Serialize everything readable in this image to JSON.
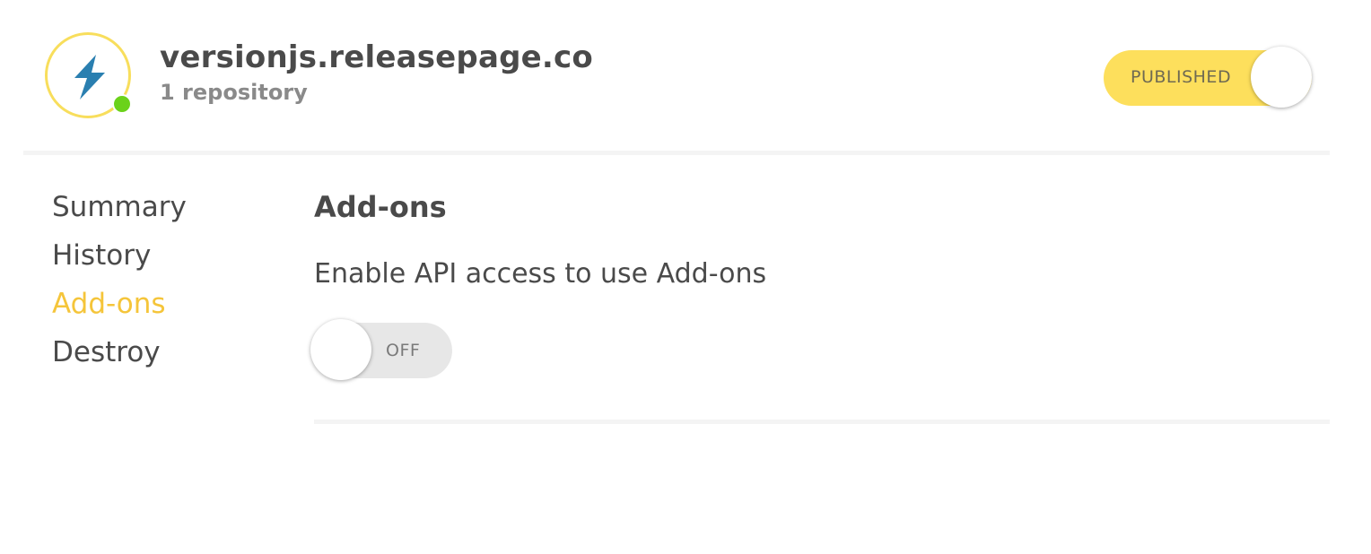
{
  "header": {
    "title": "versionjs.releasepage.co",
    "subtitle": "1 repository",
    "status": "online",
    "published_toggle": {
      "label": "PUBLISHED",
      "state": "on",
      "color": "#fddf5c"
    }
  },
  "logo": {
    "icon": "lightning-bolt-icon",
    "ring_color": "#f8de5c",
    "bolt_color": "#2a7fb0",
    "status_color": "#6bd21a"
  },
  "sidebar": {
    "items": [
      {
        "label": "Summary",
        "active": false
      },
      {
        "label": "History",
        "active": false
      },
      {
        "label": "Add-ons",
        "active": true
      },
      {
        "label": "Destroy",
        "active": false
      }
    ],
    "active_color": "#f5c53a"
  },
  "main": {
    "section_title": "Add-ons",
    "description": "Enable API access to use Add-ons",
    "api_toggle": {
      "label": "OFF",
      "state": "off"
    }
  }
}
